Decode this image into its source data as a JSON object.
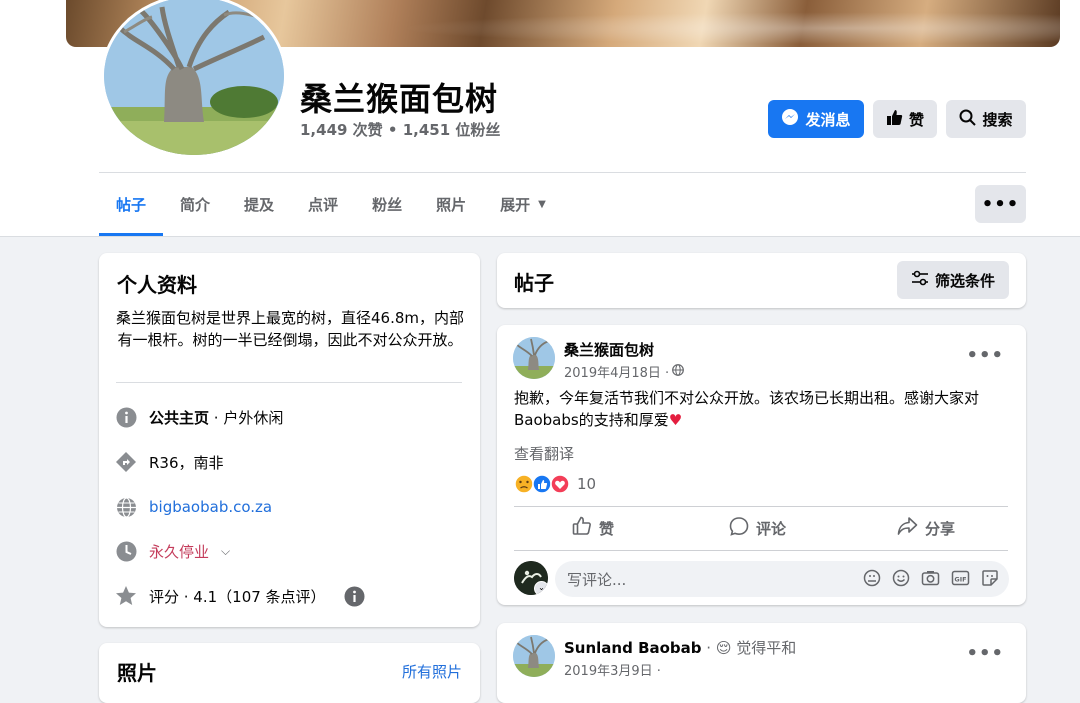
{
  "page": {
    "name": "桑兰猴面包树",
    "stats": "1,449 次赞 • 1,451 位粉丝",
    "buttons": {
      "message": "发消息",
      "like": "赞",
      "search": "搜索"
    },
    "more": "•••"
  },
  "tabs": [
    {
      "label": "帖子",
      "active": true
    },
    {
      "label": "简介"
    },
    {
      "label": "提及"
    },
    {
      "label": "点评"
    },
    {
      "label": "粉丝"
    },
    {
      "label": "照片"
    },
    {
      "label": "展开",
      "dropdown": true
    }
  ],
  "intro": {
    "title": "个人资料",
    "bio": "桑兰猴面包树是世界上最宽的树，直径46.8m，内部有一根杆。树的一半已经倒塌，因此不对公众开放。",
    "category_label": "公共主页",
    "category_value": " · 户外休闲",
    "address": "R36，南非",
    "website": "bigbaobab.co.za",
    "hours": "永久停业",
    "rating": "评分 · 4.1（107 条点评）"
  },
  "photos_card": {
    "title": "照片",
    "link": "所有照片"
  },
  "posts_header": {
    "title": "帖子",
    "filter": "筛选条件"
  },
  "posts": [
    {
      "author": "桑兰猴面包树",
      "date": "2019年4月18日 ·",
      "text": "抱歉，今年复活节我们不对公众开放。该农场已长期出租。感谢大家对Baobabs的支持和厚爱",
      "translate": "查看翻译",
      "reaction_count": "10",
      "actions": {
        "like": "赞",
        "comment": "评论",
        "share": "分享"
      },
      "comment_placeholder": "写评论..."
    },
    {
      "author": "Sunland Baobab",
      "feeling": " · 😌 觉得平和",
      "date": "2019年3月9日 ·"
    }
  ],
  "colors": {
    "brand": "#1877f2",
    "closed": "#c43c5b",
    "link": "#216fdb"
  }
}
